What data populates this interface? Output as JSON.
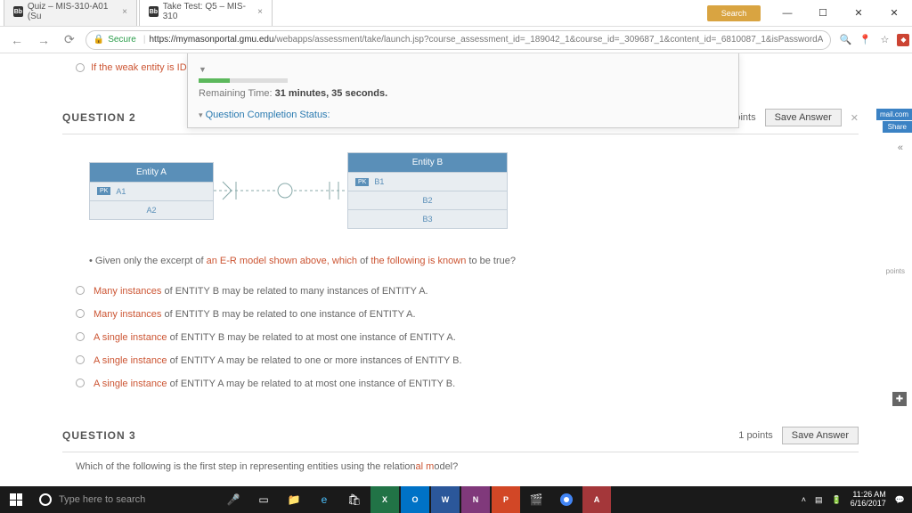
{
  "window": {
    "search_label": "Search",
    "minimize": "—",
    "maximize": "☐",
    "close": "✕"
  },
  "tabs": [
    {
      "icon": "Bb",
      "label": "Quiz – MIS-310-A01 (Su"
    },
    {
      "icon": "Bb",
      "label": "Take Test: Q5 – MIS-310"
    }
  ],
  "addressbar": {
    "secure": "Secure",
    "host": "https://mymasonportal.gmu.edu",
    "path": "/webapps/assessment/take/launch.jsp?course_assessment_id=_189042_1&course_id=_309687_1&content_id=_6810087_1&isPasswordA"
  },
  "timer": {
    "remaining_label": "Remaining Time:",
    "remaining_value": "31 minutes, 35 seconds.",
    "qcs": "Question Completion Status:"
  },
  "prev_fragment": "If the weak entity is ID-dep",
  "mail_tab": "mail.com",
  "share_tab": "Share",
  "question2": {
    "title": "QUESTION 2",
    "points": "points",
    "save": "Save Answer",
    "entityA": {
      "name": "Entity A",
      "pk": "PK",
      "a1": "A1",
      "a2": "A2"
    },
    "entityB": {
      "name": "Entity B",
      "pk": "PK",
      "b1": "B1",
      "b2": "B2",
      "b3": "B3"
    },
    "prompt_pre": "• Given only the excerpt of ",
    "prompt_red1": "an E-R model shown above, which",
    "prompt_mid": " of ",
    "prompt_red2": "the following is known",
    "prompt_post": " to be true?",
    "options": [
      {
        "red": "Many instances",
        "rest": " of ENTITY B may be related to many instances of ENTITY A."
      },
      {
        "red": "Many instances",
        "rest": " of ENTITY B may be related to one instance of ENTITY A."
      },
      {
        "red": "A single instance",
        "rest": " of ENTITY B may be related to at most one instance of ENTITY A."
      },
      {
        "red": "A single instance",
        "rest": " of ENTITY A may be related to one or more instances of ENTITY B."
      },
      {
        "red": "A single instance",
        "rest": " of ENTITY A may be related to at most one instance of ENTITY B."
      }
    ]
  },
  "question3": {
    "title": "QUESTION 3",
    "points": "1 points",
    "save": "Save Answer",
    "prompt_pre": "Which of the following is the first step in representing entities using the relation",
    "prompt_red": "al m",
    "prompt_post": "odel?"
  },
  "side_points": "points",
  "taskbar": {
    "search_placeholder": "Type here to search",
    "time": "11:26 AM",
    "date": "6/16/2017"
  }
}
